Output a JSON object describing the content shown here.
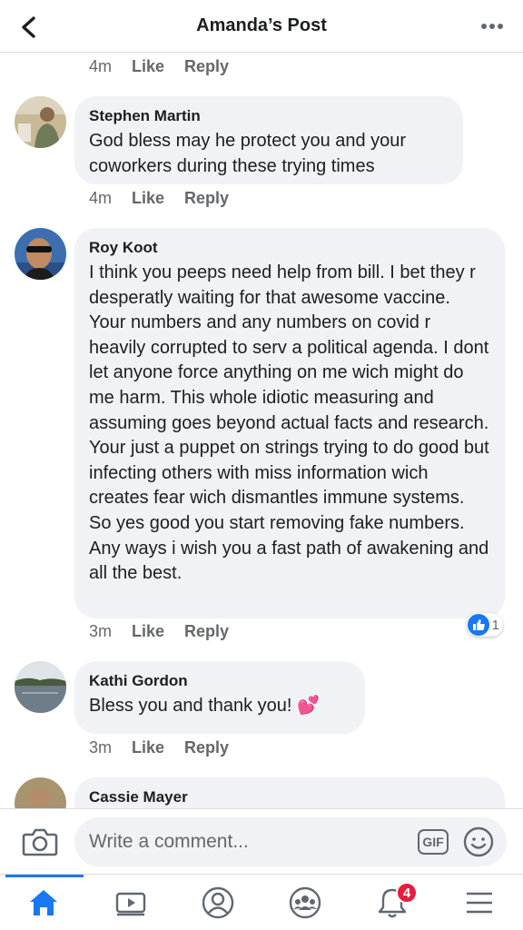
{
  "header": {
    "title": "Amanda’s Post"
  },
  "top_meta": {
    "time": "4m",
    "like": "Like",
    "reply": "Reply"
  },
  "comments": [
    {
      "author": "Stephen Martin",
      "text": "God bless may he protect you and your coworkers during these trying times",
      "time": "4m",
      "like": "Like",
      "reply": "Reply"
    },
    {
      "author": "Roy Koot",
      "text": "I think you peeps need help from bill. I bet they r desperatly waiting for that awesome vaccine. Your numbers and any numbers on covid r heavily corrupted to serv a political agenda. I dont let anyone force anything on me wich might do me harm. This whole idiotic measuring and assuming goes beyond actual facts and research. Your just a puppet on strings trying to do good but infecting others with miss information wich creates fear wich dismantles immune systems. So yes good you start removing fake numbers. Any ways i wish you a fast path of awakening and all the best.",
      "time": "3m",
      "like": "Like",
      "reply": "Reply",
      "reaction": {
        "icon": "like-reaction-icon",
        "count": "1"
      }
    },
    {
      "author": "Kathi Gordon",
      "text": "Bless you and thank you! 💕",
      "time": "3m",
      "like": "Like",
      "reply": "Reply"
    },
    {
      "author": "Cassie Mayer",
      "text": ""
    }
  ],
  "composer": {
    "placeholder": "Write a comment...",
    "gif_label": "GIF"
  },
  "tabbar": {
    "tabs": [
      "home-icon",
      "video-icon",
      "profile-icon",
      "groups-icon",
      "notifications-icon",
      "menu-icon"
    ],
    "notifications_badge": "4",
    "active": "home-icon"
  },
  "colors": {
    "accent": "#1877f2",
    "bubble": "#f0f2f5",
    "badge": "#e41e3f",
    "muted": "#65676b"
  }
}
